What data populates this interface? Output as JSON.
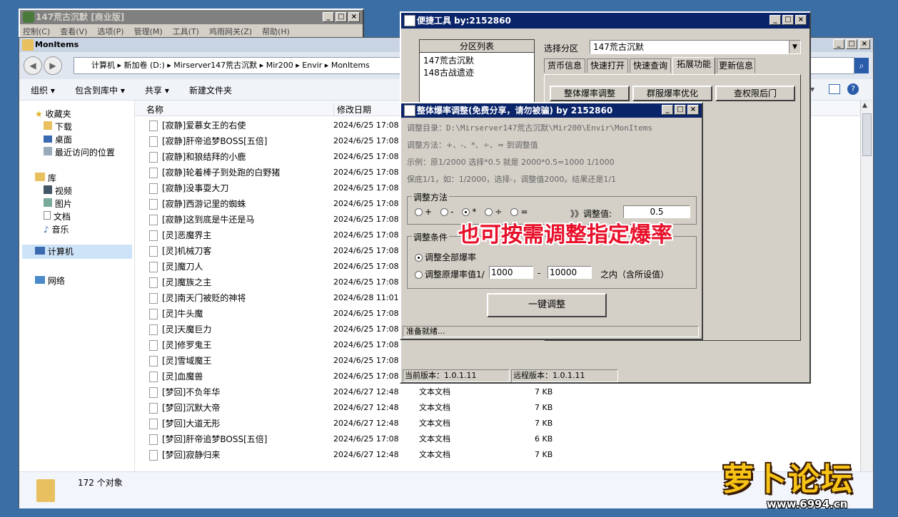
{
  "main_app": {
    "title": "147荒古沉默 [商业版]",
    "menu": [
      "控制(C)",
      "查看(V)",
      "选项(P)",
      "管理(M)",
      "工具(T)",
      "鸡雨网关(Z)",
      "帮助(H)"
    ]
  },
  "explorer": {
    "title": "MonItems",
    "address": [
      "计算机",
      "新加卷 (D:)",
      "Mirserver147荒古沉默",
      "Mir200",
      "Envir",
      "MonItems"
    ],
    "toolbar": [
      "组织 ▾",
      "包含到库中 ▾",
      "共享 ▾",
      "新建文件夹"
    ],
    "nav": {
      "favorites": "收藏夹",
      "fav_items": [
        "下载",
        "桌面",
        "最近访问的位置"
      ],
      "libraries": "库",
      "lib_items": [
        "视频",
        "图片",
        "文档",
        "音乐"
      ],
      "computer": "计算机",
      "network": "网络"
    },
    "columns": {
      "name": "名称",
      "modified": "修改日期"
    },
    "files": [
      {
        "name": "[寂静]爱慕女王的右使",
        "date": "2024/6/25 17:08",
        "type": "",
        "size": ""
      },
      {
        "name": "[寂静]肝帝追梦BOSS[五倍]",
        "date": "2024/6/25 17:08",
        "type": "",
        "size": ""
      },
      {
        "name": "[寂静]和狼结拜的小鹿",
        "date": "2024/6/25 17:08",
        "type": "",
        "size": ""
      },
      {
        "name": "[寂静]轮着棒子到处跑的白野猪",
        "date": "2024/6/25 17:08",
        "type": "",
        "size": ""
      },
      {
        "name": "[寂静]没事耍大刀",
        "date": "2024/6/25 17:08",
        "type": "",
        "size": ""
      },
      {
        "name": "[寂静]西游记里的蜘蛛",
        "date": "2024/6/25 17:08",
        "type": "",
        "size": ""
      },
      {
        "name": "[寂静]这到底是牛还是马",
        "date": "2024/6/25 17:08",
        "type": "",
        "size": ""
      },
      {
        "name": "[灵]恶魔界主",
        "date": "2024/6/25 17:08",
        "type": "",
        "size": ""
      },
      {
        "name": "[灵]机械刀客",
        "date": "2024/6/25 17:08",
        "type": "",
        "size": ""
      },
      {
        "name": "[灵]魔刀人",
        "date": "2024/6/25 17:08",
        "type": "",
        "size": ""
      },
      {
        "name": "[灵]魔族之主",
        "date": "2024/6/25 17:08",
        "type": "",
        "size": ""
      },
      {
        "name": "[灵]南天门被贬的神将",
        "date": "2024/6/28 11:01",
        "type": "",
        "size": ""
      },
      {
        "name": "[灵]牛头魔",
        "date": "2024/6/25 17:08",
        "type": "",
        "size": ""
      },
      {
        "name": "[灵]天魔巨力",
        "date": "2024/6/25 17:08",
        "type": "",
        "size": ""
      },
      {
        "name": "[灵]修罗鬼王",
        "date": "2024/6/25 17:08",
        "type": "",
        "size": ""
      },
      {
        "name": "[灵]雪域魔王",
        "date": "2024/6/25 17:08",
        "type": "",
        "size": ""
      },
      {
        "name": "[灵]血魔兽",
        "date": "2024/6/25 17:08",
        "type": "",
        "size": ""
      },
      {
        "name": "[梦回]不负年华",
        "date": "2024/6/27 12:48",
        "type": "文本文档",
        "size": "7 KB"
      },
      {
        "name": "[梦回]沉默大帝",
        "date": "2024/6/27 12:48",
        "type": "文本文档",
        "size": "7 KB"
      },
      {
        "name": "[梦回]大道无形",
        "date": "2024/6/27 12:48",
        "type": "文本文档",
        "size": "7 KB"
      },
      {
        "name": "[梦回]肝帝追梦BOSS[五倍]",
        "date": "2024/6/25 17:08",
        "type": "文本文档",
        "size": "6 KB"
      },
      {
        "name": "[梦回]寂静归来",
        "date": "2024/6/27 12:48",
        "type": "文本文档",
        "size": "7 KB"
      }
    ],
    "status": "172 个对象"
  },
  "tool": {
    "title": "便捷工具   by:2152860",
    "partition_list_label": "分区列表",
    "partitions": [
      "147荒古沉默",
      "148古战遗迹"
    ],
    "select_label": "选择分区",
    "select_value": "147荒古沉默",
    "tabs": [
      "货币信息",
      "快速打开",
      "快速查询",
      "拓展功能",
      "更新信息"
    ],
    "buttons": [
      "整体爆率调整",
      "群服爆率优化",
      "查权限后门"
    ],
    "local_version": "当前版本：1.0.1.11",
    "remote_version": "远程版本：1.0.1.11"
  },
  "dialog": {
    "title": "整体爆率调整(免费分享，请勿被骗)    by 2152860",
    "dir_line": "调整目录：D:\\Mirserver147荒古沉默\\Mir200\\Envir\\MonItems",
    "method_line": "调整方法：+、-、*、÷、=  到调整值",
    "example_line": "示例：原1/2000 选择*0.5 就是 2000*0.5=1000  1/1000",
    "floor_line": "保底1/1，如：1/2000，选择-，调整值2000。结果还是1/1",
    "method_group": "调整方法",
    "ops": [
      "+",
      "-",
      "*",
      "÷",
      "="
    ],
    "value_label": "》》调整值:",
    "value": "0.5",
    "cond_group": "调整条件",
    "cond_all": "调整全部爆率",
    "cond_range": "调整原爆率值1/",
    "range_from": "1000",
    "range_dash": "-",
    "range_to": "10000",
    "range_suffix": "之内（含所设值）",
    "run_button": "一键调整",
    "status": "准备就绪..."
  },
  "overlay_caption": "也可按需调整指定爆率",
  "watermark": {
    "brand": "萝卜论坛",
    "url": "www.6994.cn"
  }
}
